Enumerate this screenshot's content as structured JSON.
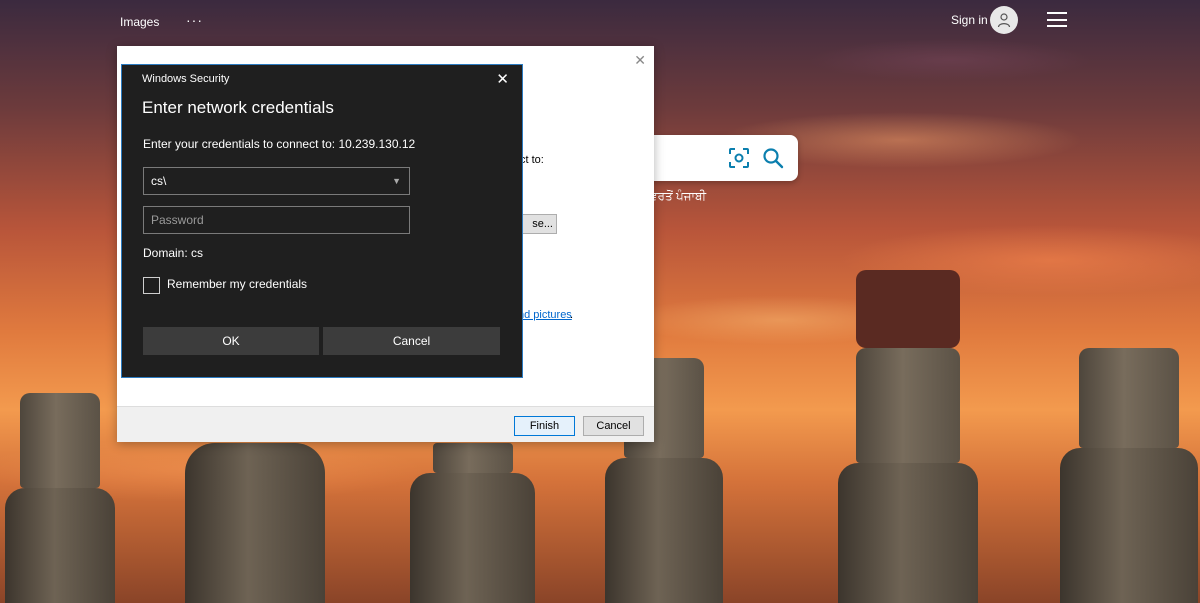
{
  "topbar": {
    "images_label": "Images",
    "more_label": "···",
    "signin_label": "Sign in"
  },
  "background": {
    "language_text": "ਵਰਤੋਂ  ਪੰਜਾਬੀ"
  },
  "wizard": {
    "connect_fragment": "ct to:",
    "browse_label": "se...",
    "link_fragment": "nd pictures",
    "period": ".",
    "finish_label": "Finish",
    "cancel_label": "Cancel",
    "close_glyph": "✕"
  },
  "security_dialog": {
    "window_title": "Windows Security",
    "close_glyph": "✕",
    "heading": "Enter network credentials",
    "prompt": "Enter your credentials to connect to: 10.239.130.12",
    "username_value": "cs\\",
    "password_placeholder": "Password",
    "domain_text": "Domain: cs",
    "remember_label": "Remember my credentials",
    "ok_label": "OK",
    "cancel_label": "Cancel"
  },
  "colors": {
    "dialog_bg": "#1f1f1f",
    "dialog_border": "#2b7bc1",
    "button_bg": "#3c3c3c",
    "accent": "#0078d7"
  },
  "icons": {
    "visual_search": "visual-search-icon",
    "search": "search-icon",
    "user": "user-icon",
    "menu": "hamburger-icon"
  }
}
